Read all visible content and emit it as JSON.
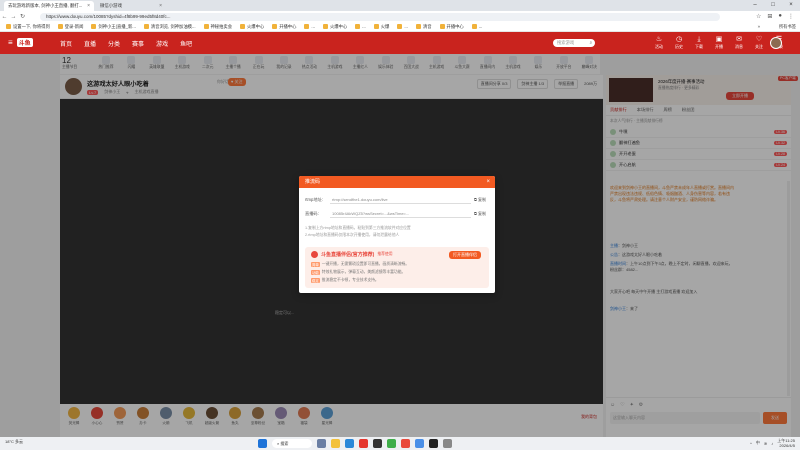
{
  "browser": {
    "tabs": [
      {
        "title": "去玩游戏新版本, 剑神小王直播, 翻打...",
        "active": true
      },
      {
        "title": "微信小游戏",
        "active": false
      }
    ],
    "url": "https://www.douyu.com/10085?dyshid=4f8b99-99ed5f8d40fc...",
    "bookmarks": [
      "设置一下, 你将得到",
      "登录-新闻",
      "剑神小王(直播_新...",
      "清音浏览, 剑神加油模...",
      "神秘拍卖会",
      "火爆中心",
      "开播中心",
      "...",
      "火爆中心",
      "...",
      "火爆",
      "...",
      "清音",
      "开播中心",
      "..."
    ],
    "bookmarks_more": "»",
    "bookmarks_all": "所有书签"
  },
  "site": {
    "nav": [
      "首页",
      "直播",
      "分类",
      "赛事",
      "游戏",
      "鱼吧"
    ],
    "search_placeholder": "搜索游戏",
    "header_icons": [
      {
        "icon": "fire-icon",
        "label": "活动"
      },
      {
        "icon": "history-icon",
        "label": "历史"
      },
      {
        "icon": "download-icon",
        "label": "下载"
      },
      {
        "icon": "broadcast-icon",
        "label": "开播"
      },
      {
        "icon": "message-icon",
        "label": "消息"
      },
      {
        "icon": "subscribe-icon",
        "label": "关注"
      },
      {
        "icon": "record-icon",
        "label": "记录"
      }
    ]
  },
  "categories": {
    "up_count": "12",
    "up_label": "主播节目",
    "items": [
      "热门推荐",
      "闪耀",
      "英雄联盟",
      "主机游戏",
      "二次元",
      "主播个播",
      "正在玩",
      "我的记录",
      "热点活动",
      "主机游戏",
      "主播红人",
      "娱乐体验",
      "百团大战",
      "主机游戏",
      "斗鱼大赛",
      "直播间内",
      "主机游戏",
      "娱乐",
      "开放平台",
      "巅峰对决",
      "万能娱乐"
    ]
  },
  "room": {
    "title": "这游戏太好人眼小吃着",
    "tag": "你好话题",
    "follow_label": "关注",
    "level": "Lv.7",
    "meta_name": "剑神小王",
    "meta_tag": "主机游戏直播",
    "right_boxes": [
      "直播间分享 0/3",
      "剑神主播 1/3"
    ],
    "report": "举报直播",
    "hot": "2089万"
  },
  "player": {
    "hint": "稳定可以..."
  },
  "gifts": [
    "荧光棒",
    "小心心",
    "赞赞",
    "办卡",
    "火箭",
    "飞机",
    "超级火箭",
    "鱼丸",
    "至尊粉丝",
    "宝箱",
    "福袋",
    "星光棒"
  ],
  "gift_right": "我的背包",
  "sidebar": {
    "promo_title": "2026年度开播·赛事活动",
    "promo_sub": "直播热度排行 · 更多精彩",
    "promo_button": "立即开播",
    "pc_badge": "PC客户端",
    "tabs": [
      "贡献排行",
      "本场排行",
      "周榜",
      "粉丝团"
    ],
    "rank_header": "本次人气排行  ·  主播贡献排行榜",
    "ranks": [
      {
        "name": "牛嘿",
        "badge": "LV.36"
      },
      {
        "name": "翻神打遍鱼",
        "badge": "LV.32"
      },
      {
        "name": "开开老蛋",
        "badge": "LV.28"
      },
      {
        "name": "开心启航",
        "badge": "LV.24"
      }
    ],
    "system_message": "欢迎来到剑神小王的直播间，斗鱼严禁未成年人直播或打赏。直播间内严禁出现违法违规、低俗色情、吸烟酗酒、人身伤害等内容，若有违反，斗鱼将严肃处理。请注意个人财产安全，谨防网络诈骗。",
    "chat": [
      {
        "user": "主播",
        "text": "剑神小王"
      },
      {
        "user": "公告",
        "text": "这游戏太好人眼小吃着"
      },
      {
        "user": "直播时间",
        "text": "上午10点到下午3点，晚上不定时，闲聊直播，欢迎来玩，粉丝群：4582..."
      },
      {
        "user": "",
        "text": "大家开心吧 每天中午开播 主打游戏直播 欢迎加入"
      },
      {
        "user": "剑神小王",
        "text": "来了"
      }
    ],
    "chat_placeholder": "这里输入聊天内容",
    "send": "发送"
  },
  "modal": {
    "title": "推流码",
    "rtmp_label": "rtmp地址:",
    "rtmp_value": "rtmp://sendfhe1.douyu.com/live",
    "stream_label": "直播码:",
    "stream_value": "10085r4AkWQZ5?wsSecret=...&wsTime=...",
    "copy_label": "复制",
    "tips": [
      "1.复制上方rtmp地址和直播码，粘贴到第三方推流软件对应位置",
      "2.rtmp地址和直播码仅限本次开播使用，请勿泄露给他人"
    ],
    "card_title": "斗鱼直播伴侣(官方推荐)",
    "card_tag": "推荐使用",
    "card_button": "打开直播伴侣",
    "card_lines": [
      {
        "tag": "简单",
        "text": "一键开播，无需繁琐设置即可直播，画质清晰流畅。"
      },
      {
        "tag": "功能",
        "text": "特效礼物展示，弹幕互动，美颜滤镜等丰富功能。"
      },
      {
        "tag": "稳定",
        "text": "推流稳定不卡顿，专业技术支持。"
      }
    ]
  },
  "taskbar": {
    "weather": "18°C 多云",
    "search": "搜索",
    "time": "上午11:25",
    "date": "2026/4/5"
  },
  "colors": {
    "brand": "#c9231e",
    "modal_accent": "#f25a22"
  }
}
